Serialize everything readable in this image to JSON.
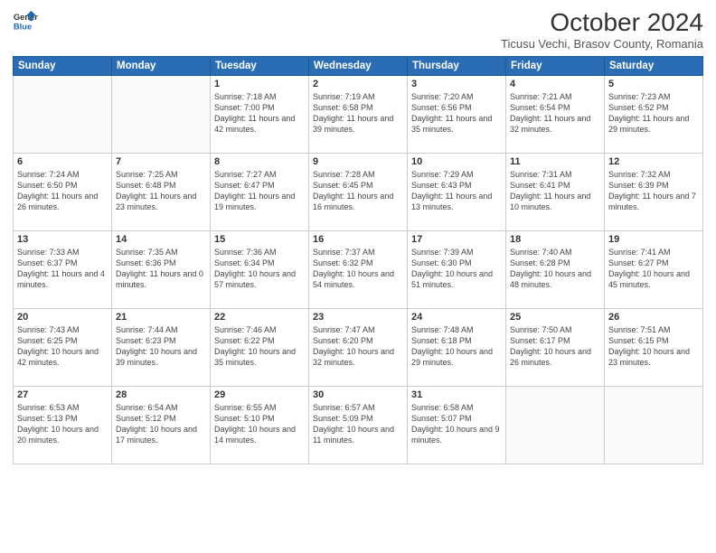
{
  "header": {
    "logo_line1": "General",
    "logo_line2": "Blue",
    "month_title": "October 2024",
    "subtitle": "Ticusu Vechi, Brasov County, Romania"
  },
  "weekdays": [
    "Sunday",
    "Monday",
    "Tuesday",
    "Wednesday",
    "Thursday",
    "Friday",
    "Saturday"
  ],
  "weeks": [
    [
      {
        "day": "",
        "sunrise": "",
        "sunset": "",
        "daylight": ""
      },
      {
        "day": "",
        "sunrise": "",
        "sunset": "",
        "daylight": ""
      },
      {
        "day": "1",
        "sunrise": "Sunrise: 7:18 AM",
        "sunset": "Sunset: 7:00 PM",
        "daylight": "Daylight: 11 hours and 42 minutes."
      },
      {
        "day": "2",
        "sunrise": "Sunrise: 7:19 AM",
        "sunset": "Sunset: 6:58 PM",
        "daylight": "Daylight: 11 hours and 39 minutes."
      },
      {
        "day": "3",
        "sunrise": "Sunrise: 7:20 AM",
        "sunset": "Sunset: 6:56 PM",
        "daylight": "Daylight: 11 hours and 35 minutes."
      },
      {
        "day": "4",
        "sunrise": "Sunrise: 7:21 AM",
        "sunset": "Sunset: 6:54 PM",
        "daylight": "Daylight: 11 hours and 32 minutes."
      },
      {
        "day": "5",
        "sunrise": "Sunrise: 7:23 AM",
        "sunset": "Sunset: 6:52 PM",
        "daylight": "Daylight: 11 hours and 29 minutes."
      }
    ],
    [
      {
        "day": "6",
        "sunrise": "Sunrise: 7:24 AM",
        "sunset": "Sunset: 6:50 PM",
        "daylight": "Daylight: 11 hours and 26 minutes."
      },
      {
        "day": "7",
        "sunrise": "Sunrise: 7:25 AM",
        "sunset": "Sunset: 6:48 PM",
        "daylight": "Daylight: 11 hours and 23 minutes."
      },
      {
        "day": "8",
        "sunrise": "Sunrise: 7:27 AM",
        "sunset": "Sunset: 6:47 PM",
        "daylight": "Daylight: 11 hours and 19 minutes."
      },
      {
        "day": "9",
        "sunrise": "Sunrise: 7:28 AM",
        "sunset": "Sunset: 6:45 PM",
        "daylight": "Daylight: 11 hours and 16 minutes."
      },
      {
        "day": "10",
        "sunrise": "Sunrise: 7:29 AM",
        "sunset": "Sunset: 6:43 PM",
        "daylight": "Daylight: 11 hours and 13 minutes."
      },
      {
        "day": "11",
        "sunrise": "Sunrise: 7:31 AM",
        "sunset": "Sunset: 6:41 PM",
        "daylight": "Daylight: 11 hours and 10 minutes."
      },
      {
        "day": "12",
        "sunrise": "Sunrise: 7:32 AM",
        "sunset": "Sunset: 6:39 PM",
        "daylight": "Daylight: 11 hours and 7 minutes."
      }
    ],
    [
      {
        "day": "13",
        "sunrise": "Sunrise: 7:33 AM",
        "sunset": "Sunset: 6:37 PM",
        "daylight": "Daylight: 11 hours and 4 minutes."
      },
      {
        "day": "14",
        "sunrise": "Sunrise: 7:35 AM",
        "sunset": "Sunset: 6:36 PM",
        "daylight": "Daylight: 11 hours and 0 minutes."
      },
      {
        "day": "15",
        "sunrise": "Sunrise: 7:36 AM",
        "sunset": "Sunset: 6:34 PM",
        "daylight": "Daylight: 10 hours and 57 minutes."
      },
      {
        "day": "16",
        "sunrise": "Sunrise: 7:37 AM",
        "sunset": "Sunset: 6:32 PM",
        "daylight": "Daylight: 10 hours and 54 minutes."
      },
      {
        "day": "17",
        "sunrise": "Sunrise: 7:39 AM",
        "sunset": "Sunset: 6:30 PM",
        "daylight": "Daylight: 10 hours and 51 minutes."
      },
      {
        "day": "18",
        "sunrise": "Sunrise: 7:40 AM",
        "sunset": "Sunset: 6:28 PM",
        "daylight": "Daylight: 10 hours and 48 minutes."
      },
      {
        "day": "19",
        "sunrise": "Sunrise: 7:41 AM",
        "sunset": "Sunset: 6:27 PM",
        "daylight": "Daylight: 10 hours and 45 minutes."
      }
    ],
    [
      {
        "day": "20",
        "sunrise": "Sunrise: 7:43 AM",
        "sunset": "Sunset: 6:25 PM",
        "daylight": "Daylight: 10 hours and 42 minutes."
      },
      {
        "day": "21",
        "sunrise": "Sunrise: 7:44 AM",
        "sunset": "Sunset: 6:23 PM",
        "daylight": "Daylight: 10 hours and 39 minutes."
      },
      {
        "day": "22",
        "sunrise": "Sunrise: 7:46 AM",
        "sunset": "Sunset: 6:22 PM",
        "daylight": "Daylight: 10 hours and 35 minutes."
      },
      {
        "day": "23",
        "sunrise": "Sunrise: 7:47 AM",
        "sunset": "Sunset: 6:20 PM",
        "daylight": "Daylight: 10 hours and 32 minutes."
      },
      {
        "day": "24",
        "sunrise": "Sunrise: 7:48 AM",
        "sunset": "Sunset: 6:18 PM",
        "daylight": "Daylight: 10 hours and 29 minutes."
      },
      {
        "day": "25",
        "sunrise": "Sunrise: 7:50 AM",
        "sunset": "Sunset: 6:17 PM",
        "daylight": "Daylight: 10 hours and 26 minutes."
      },
      {
        "day": "26",
        "sunrise": "Sunrise: 7:51 AM",
        "sunset": "Sunset: 6:15 PM",
        "daylight": "Daylight: 10 hours and 23 minutes."
      }
    ],
    [
      {
        "day": "27",
        "sunrise": "Sunrise: 6:53 AM",
        "sunset": "Sunset: 5:13 PM",
        "daylight": "Daylight: 10 hours and 20 minutes."
      },
      {
        "day": "28",
        "sunrise": "Sunrise: 6:54 AM",
        "sunset": "Sunset: 5:12 PM",
        "daylight": "Daylight: 10 hours and 17 minutes."
      },
      {
        "day": "29",
        "sunrise": "Sunrise: 6:55 AM",
        "sunset": "Sunset: 5:10 PM",
        "daylight": "Daylight: 10 hours and 14 minutes."
      },
      {
        "day": "30",
        "sunrise": "Sunrise: 6:57 AM",
        "sunset": "Sunset: 5:09 PM",
        "daylight": "Daylight: 10 hours and 11 minutes."
      },
      {
        "day": "31",
        "sunrise": "Sunrise: 6:58 AM",
        "sunset": "Sunset: 5:07 PM",
        "daylight": "Daylight: 10 hours and 9 minutes."
      },
      {
        "day": "",
        "sunrise": "",
        "sunset": "",
        "daylight": ""
      },
      {
        "day": "",
        "sunrise": "",
        "sunset": "",
        "daylight": ""
      }
    ]
  ]
}
